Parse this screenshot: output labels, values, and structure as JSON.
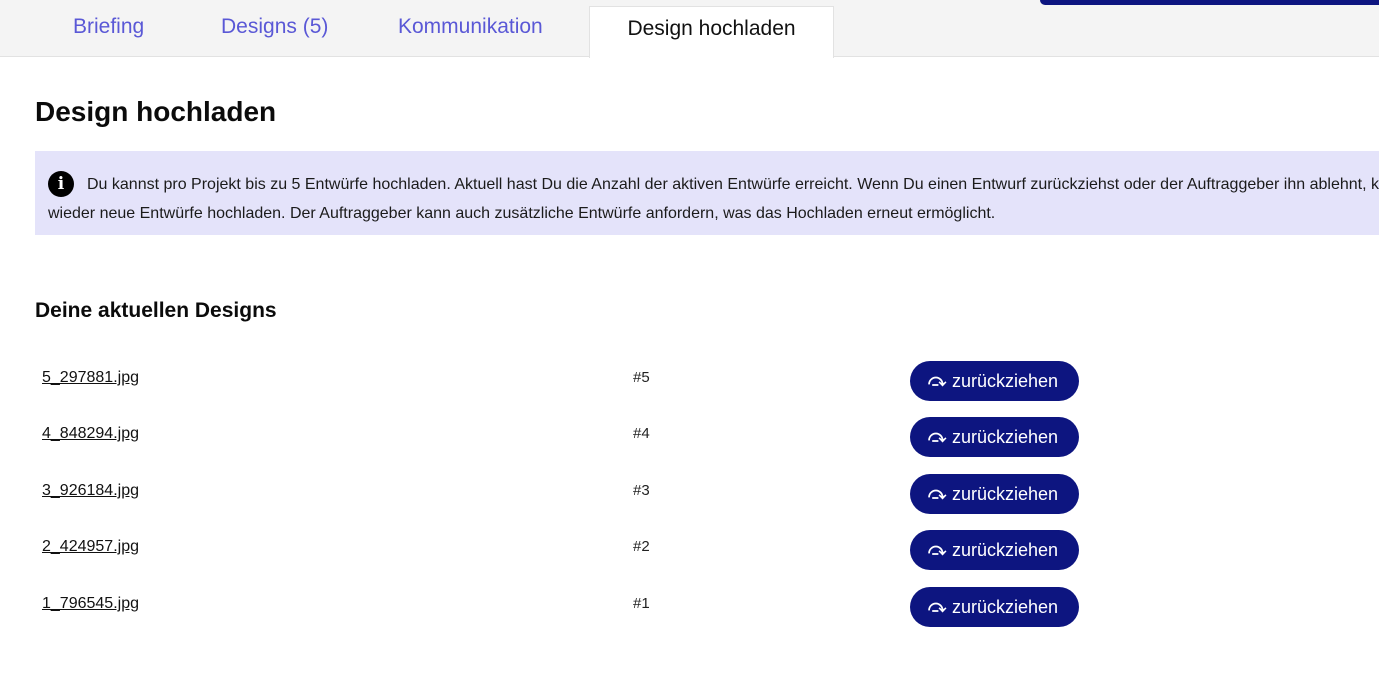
{
  "tabs": [
    {
      "label": "Briefing"
    },
    {
      "label": "Designs (5)"
    },
    {
      "label": "Kommunikation"
    },
    {
      "label": "Design hochladen",
      "active": true
    }
  ],
  "heading": "Design hochladen",
  "info": {
    "icon": "info-icon",
    "text": "Du kannst pro Projekt bis zu 5 Entwürfe hochladen. Aktuell hast Du die Anzahl der aktiven Entwürfe erreicht. Wenn Du einen Entwurf zurückziehst oder der Auftraggeber ihn ablehnt, kannst Du wieder neue Entwürfe hochladen. Der Auftraggeber kann auch zusätzliche Entwürfe anfordern, was das Hochladen erneut ermöglicht."
  },
  "designs": {
    "title": "Deine aktuellen Designs",
    "items": [
      {
        "file": "5_297881.jpg",
        "number": "#5",
        "action": "zurückziehen"
      },
      {
        "file": "4_848294.jpg",
        "number": "#4",
        "action": "zurückziehen"
      },
      {
        "file": "3_926184.jpg",
        "number": "#3",
        "action": "zurückziehen"
      },
      {
        "file": "2_424957.jpg",
        "number": "#2",
        "action": "zurückziehen"
      },
      {
        "file": "1_796545.jpg",
        "number": "#1",
        "action": "zurückziehen"
      }
    ]
  },
  "colors": {
    "accent": "#0d1580",
    "tab_link": "#5a58d6",
    "info_bg": "#e4e3fa"
  }
}
